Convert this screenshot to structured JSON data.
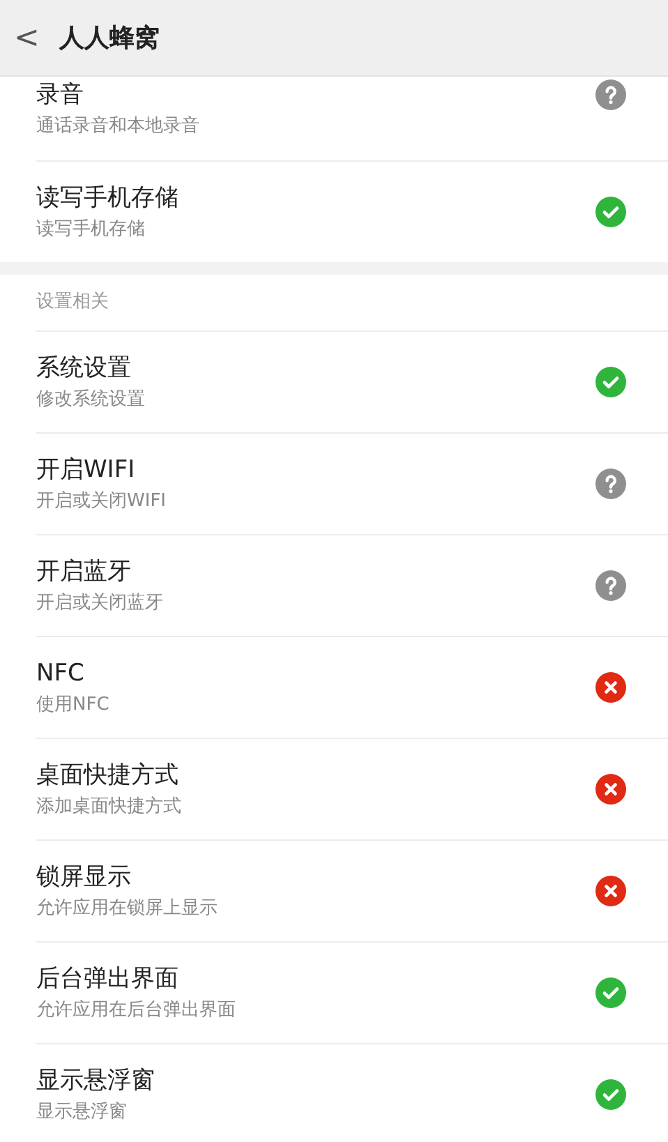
{
  "header": {
    "back": "<",
    "title": "人人蜂窝"
  },
  "sections": [
    {
      "items": [
        {
          "title": "录音",
          "subtitle": "通话录音和本地录音",
          "kind": "ask"
        },
        {
          "title": "读写手机存储",
          "subtitle": "读写手机存储",
          "kind": "allowed"
        }
      ]
    },
    {
      "heading": "设置相关",
      "items": [
        {
          "title": "系统设置",
          "subtitle": "修改系统设置",
          "kind": "allowed"
        },
        {
          "title": "开启WIFI",
          "subtitle": "开启或关闭WIFI",
          "kind": "ask"
        },
        {
          "title": "开启蓝牙",
          "subtitle": "开启或关闭蓝牙",
          "kind": "ask"
        },
        {
          "title": "NFC",
          "subtitle": "使用NFC",
          "kind": "denied"
        },
        {
          "title": "桌面快捷方式",
          "subtitle": "添加桌面快捷方式",
          "kind": "denied"
        },
        {
          "title": "锁屏显示",
          "subtitle": "允许应用在锁屏上显示",
          "kind": "denied"
        },
        {
          "title": "后台弹出界面",
          "subtitle": "允许应用在后台弹出界面",
          "kind": "allowed"
        },
        {
          "title": "显示悬浮窗",
          "subtitle": "显示悬浮窗",
          "kind": "allowed"
        }
      ]
    }
  ]
}
